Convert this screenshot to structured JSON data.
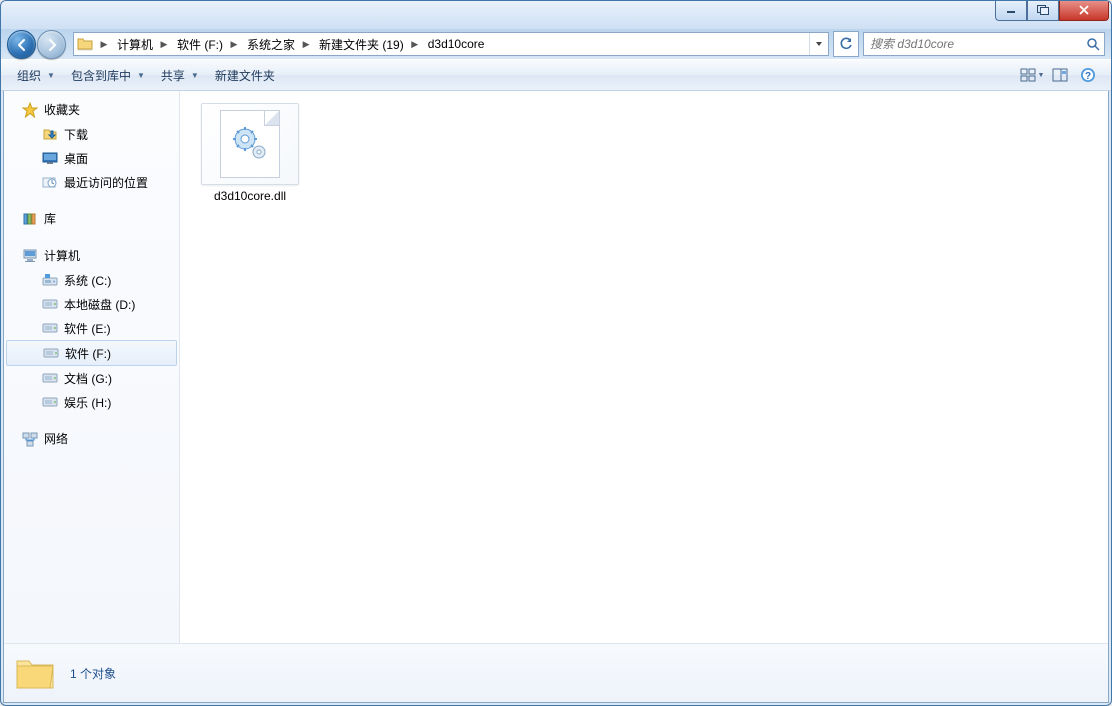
{
  "titlebar": {},
  "breadcrumbs": [
    "计算机",
    "软件 (F:)",
    "系统之家",
    "新建文件夹 (19)",
    "d3d10core"
  ],
  "search": {
    "placeholder": "搜索 d3d10core"
  },
  "toolbar": {
    "organize": "组织",
    "include": "包含到库中",
    "share": "共享",
    "newfolder": "新建文件夹"
  },
  "sidebar": {
    "favorites": {
      "label": "收藏夹",
      "items": [
        "下载",
        "桌面",
        "最近访问的位置"
      ]
    },
    "libraries": {
      "label": "库"
    },
    "computer": {
      "label": "计算机",
      "items": [
        {
          "label": "系统 (C:)",
          "selected": false,
          "type": "sys"
        },
        {
          "label": "本地磁盘 (D:)",
          "selected": false,
          "type": "hdd"
        },
        {
          "label": "软件 (E:)",
          "selected": false,
          "type": "hdd"
        },
        {
          "label": "软件 (F:)",
          "selected": true,
          "type": "hdd"
        },
        {
          "label": "文档 (G:)",
          "selected": false,
          "type": "hdd"
        },
        {
          "label": "娱乐 (H:)",
          "selected": false,
          "type": "hdd"
        }
      ]
    },
    "network": {
      "label": "网络"
    }
  },
  "files": [
    {
      "name": "d3d10core.dll"
    }
  ],
  "status": {
    "text": "1 个对象"
  }
}
